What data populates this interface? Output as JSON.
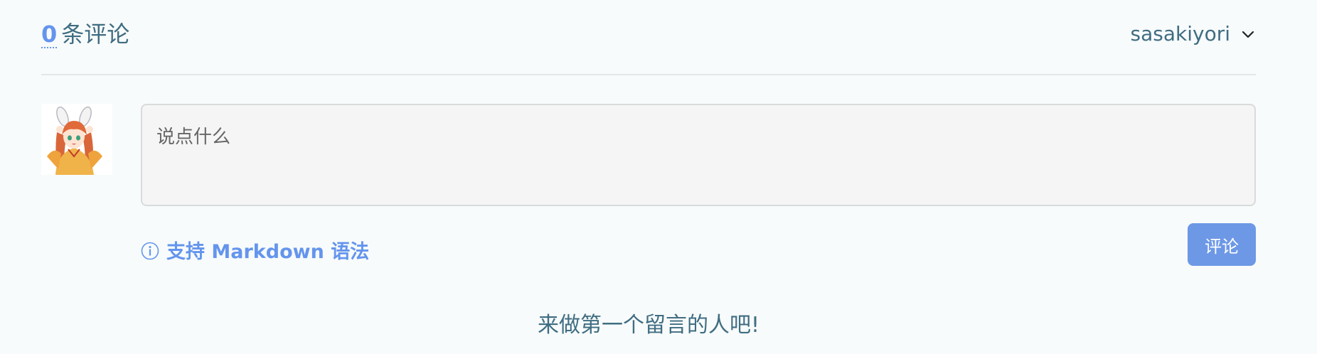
{
  "header": {
    "count": "0",
    "count_label": "条评论",
    "username": "sasakiyori",
    "chevron_icon": "chevron-down-icon"
  },
  "avatar": {
    "alt": "anime girl avatar"
  },
  "editor": {
    "placeholder": "说点什么",
    "value": ""
  },
  "markdown_hint": {
    "icon": "info-icon",
    "label": "支持 Markdown 语法"
  },
  "submit": {
    "label": "评论"
  },
  "empty_message": "来做第一个留言的人吧!",
  "colors": {
    "accent": "#6495ed",
    "button": "#6d98e6",
    "text": "#3f6d82",
    "background": "#f8fbfb"
  }
}
